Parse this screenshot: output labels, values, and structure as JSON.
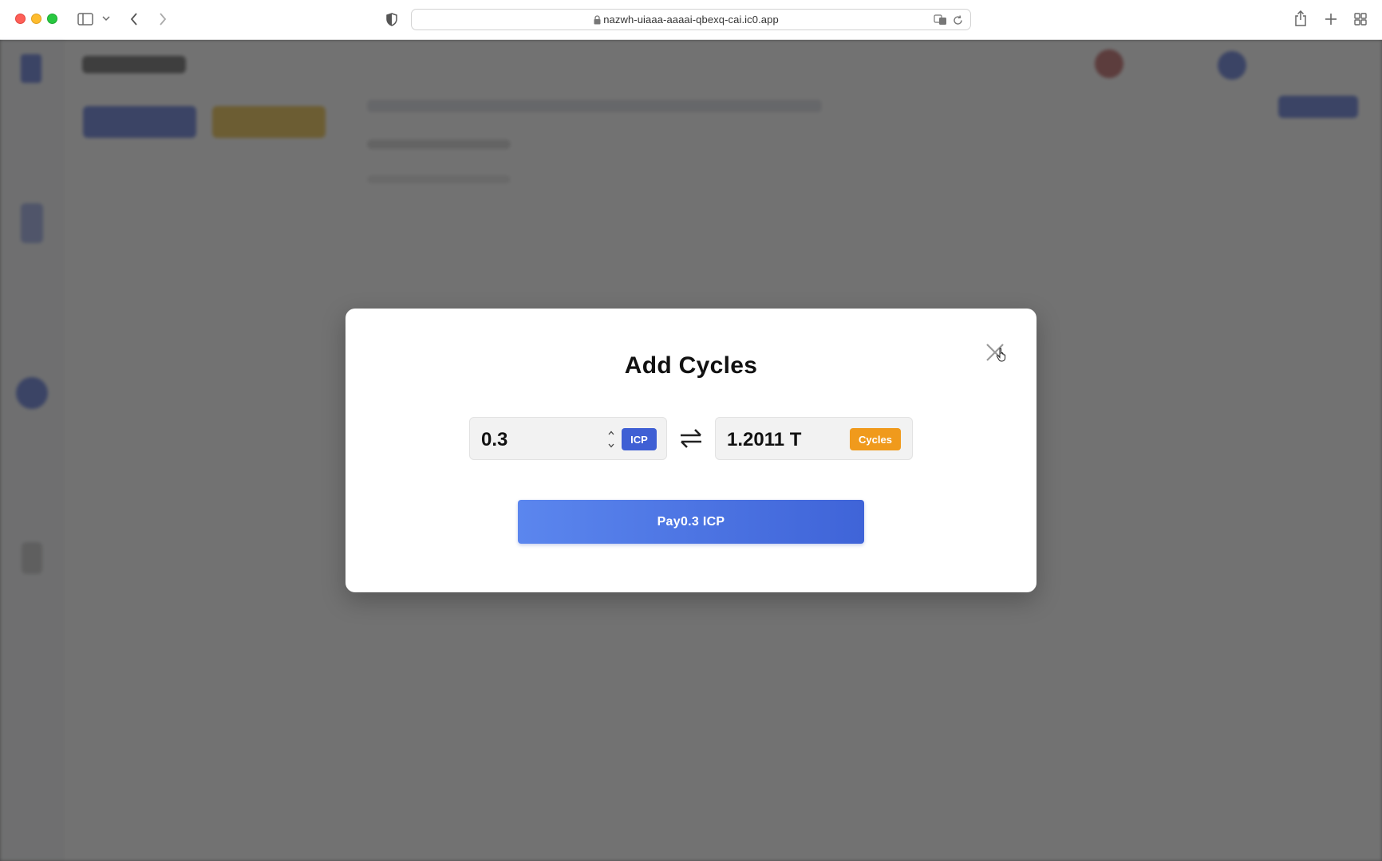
{
  "browser": {
    "url": "nazwh-uiaaa-aaaai-qbexq-cai.ic0.app",
    "icons": [
      "sidebar-icon",
      "chevron-down-icon",
      "back-icon",
      "forward-icon",
      "shield-icon",
      "lock-icon",
      "translate-icon",
      "reload-icon",
      "share-icon",
      "new-tab-icon",
      "tab-overview-icon"
    ]
  },
  "modal": {
    "title": "Add Cycles",
    "icp_amount": "0.3",
    "icp_label": "ICP",
    "cycles_amount": "1.2011 T",
    "cycles_label": "Cycles",
    "pay_label": "Pay0.3 ICP",
    "icons": [
      "close-icon",
      "swap-icon",
      "stepper-up-icon",
      "stepper-down-icon"
    ]
  },
  "colors": {
    "icp_badge": "#3f5fd4",
    "cycles_badge": "#f09a1c",
    "pay_button": "#4a73e2",
    "backdrop": "#6f6f6f"
  }
}
